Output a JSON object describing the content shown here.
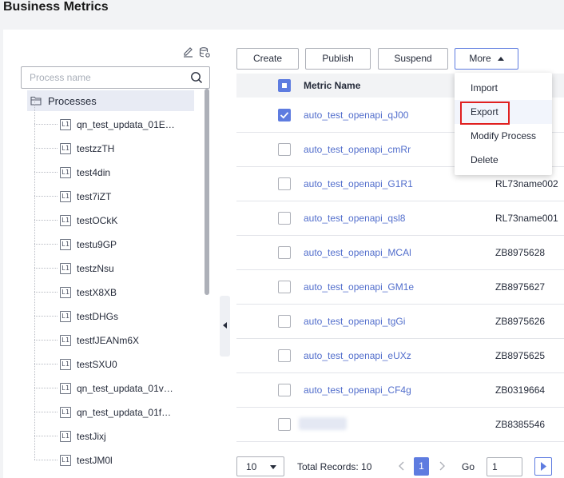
{
  "page": {
    "title": "Business Metrics"
  },
  "tree": {
    "search_placeholder": "Process name",
    "root_label": "Processes",
    "node_icon_text": "L1",
    "items": [
      "qn_test_updata_01E…",
      "testzzTH",
      "test4din",
      "test7iZT",
      "testOCkK",
      "testu9GP",
      "testzNsu",
      "testX8XB",
      "testDHGs",
      "testfJEANm6X",
      "testSXU0",
      "qn_test_updata_01v…",
      "qn_test_updata_01f…",
      "testJixj",
      "testJM0l"
    ]
  },
  "toolbar": {
    "create": "Create",
    "publish": "Publish",
    "suspend": "Suspend",
    "more": "More"
  },
  "menu": {
    "items": [
      "Import",
      "Export",
      "Modify Process",
      "Delete"
    ],
    "hovered": "Export"
  },
  "table": {
    "header_name": "Metric Name",
    "rows": [
      {
        "name": "auto_test_openapi_qJ00",
        "code": "",
        "checked": true
      },
      {
        "name": "auto_test_openapi_cmRr",
        "code": "",
        "checked": false
      },
      {
        "name": "auto_test_openapi_G1R1",
        "code": "RL73name002",
        "checked": false
      },
      {
        "name": "auto_test_openapi_qsl8",
        "code": "RL73name001",
        "checked": false
      },
      {
        "name": "auto_test_openapi_MCAl",
        "code": "ZB8975628",
        "checked": false
      },
      {
        "name": "auto_test_openapi_GM1e",
        "code": "ZB8975627",
        "checked": false
      },
      {
        "name": "auto_test_openapi_tgGi",
        "code": "ZB8975626",
        "checked": false
      },
      {
        "name": "auto_test_openapi_eUXz",
        "code": "ZB8975625",
        "checked": false
      },
      {
        "name": "auto_test_openapi_CF4g",
        "code": "ZB0319664",
        "checked": false
      },
      {
        "name": "",
        "code": "ZB8385546",
        "checked": false,
        "blurred": true
      }
    ]
  },
  "pagination": {
    "page_size": "10",
    "total": "Total Records: 10",
    "current_page": "1",
    "go_label": "Go",
    "goto_value": "1"
  },
  "colors": {
    "accent": "#5e7ce0",
    "link": "#526ecc",
    "highlight_outline": "#e02020"
  }
}
